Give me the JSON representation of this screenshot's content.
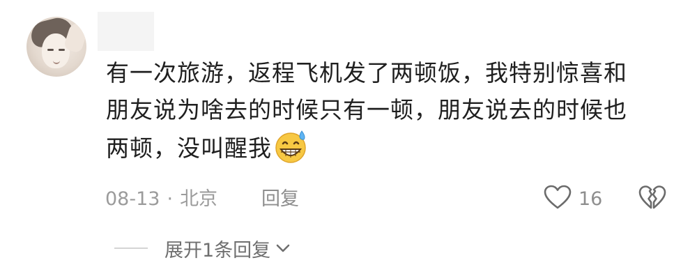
{
  "comment": {
    "lines": [
      "有一次旅游，返程飞机发了两顿饭，我特别惊喜和",
      "朋友说为啥去的时候只有一顿，朋友说去的时候也",
      "两顿，没叫醒我"
    ],
    "emoji": "grinning-sweat-emoji",
    "date": "08-13",
    "separator": "·",
    "location": "北京",
    "reply_label": "回复",
    "like_count": "16",
    "expand_label": "展开1条回复"
  },
  "colors": {
    "text": "#1f1f1f",
    "meta": "#9b9b9b",
    "icon": "#6b6b6b",
    "emoji_face": "#f7c843"
  }
}
